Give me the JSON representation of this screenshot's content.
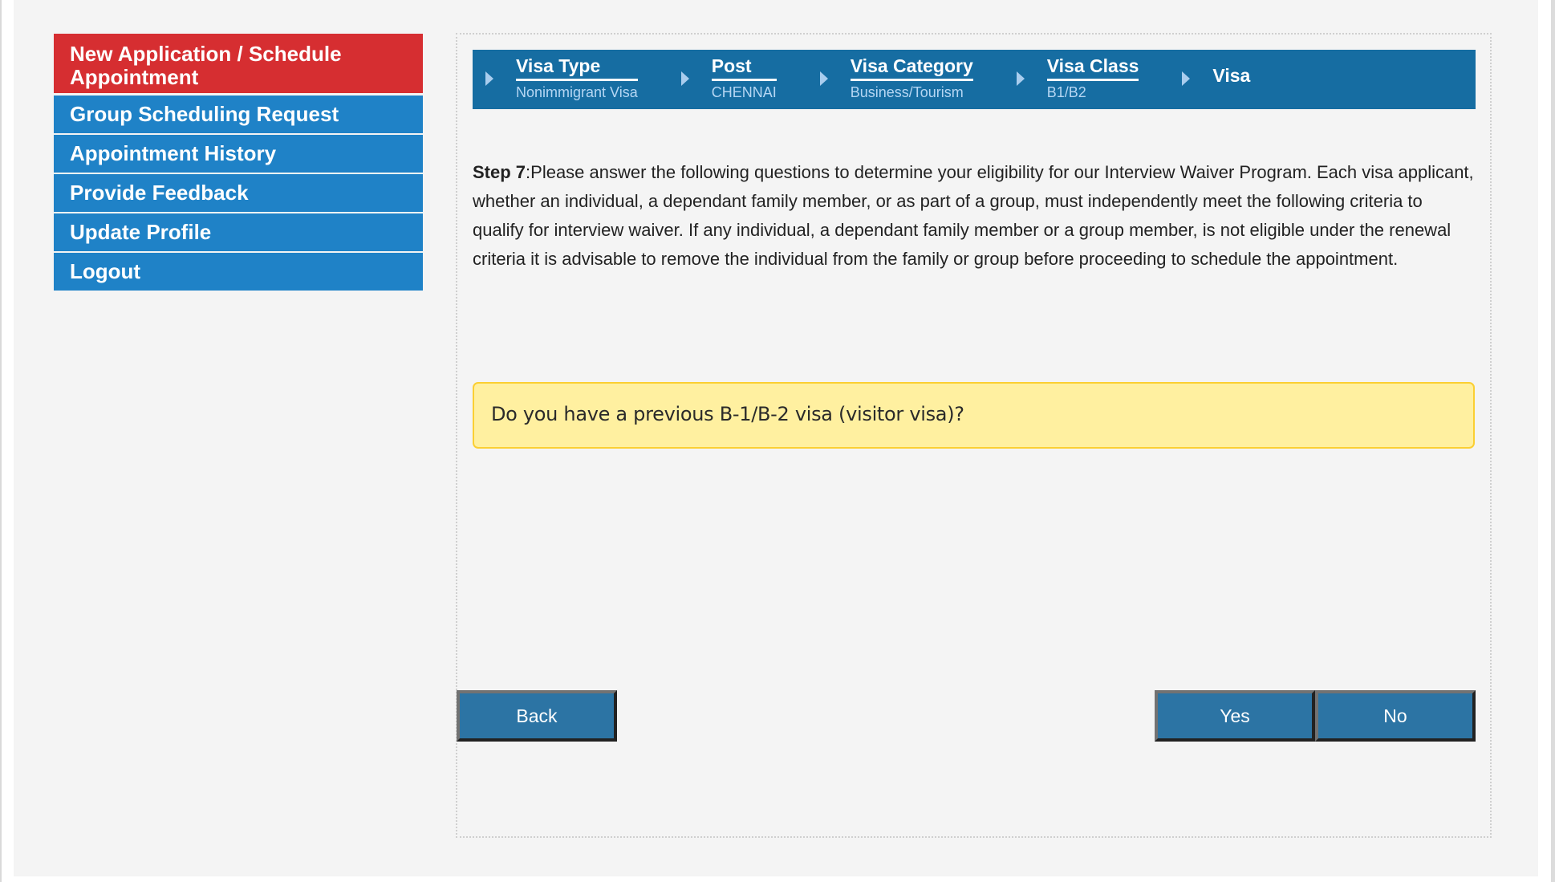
{
  "sidebar": {
    "items": [
      {
        "label": "New Application / Schedule Appointment",
        "active": true
      },
      {
        "label": "Group Scheduling Request"
      },
      {
        "label": "Appointment History"
      },
      {
        "label": "Provide Feedback"
      },
      {
        "label": "Update Profile"
      },
      {
        "label": "Logout"
      }
    ]
  },
  "breadcrumb": [
    {
      "title": "Visa Type",
      "value": "Nonimmigrant Visa"
    },
    {
      "title": "Post",
      "value": "CHENNAI"
    },
    {
      "title": "Visa Category",
      "value": "Business/Tourism"
    },
    {
      "title": "Visa Class",
      "value": "B1/B2"
    },
    {
      "title": "Visa"
    }
  ],
  "step": {
    "label": "Step 7",
    "text": ":Please answer the following questions to determine your eligibility for our Interview Waiver Program. Each visa applicant, whether an individual, a dependant family member, or as part of a group, must independently meet the following criteria to qualify for interview waiver. If any individual, a dependant family member or a group member, is not eligible under the renewal criteria it is advisable to remove the individual from the family or group before proceeding to schedule the appointment."
  },
  "question": "Do you have a previous B-1/B-2 visa (visitor visa)?",
  "buttons": {
    "back": "Back",
    "yes": "Yes",
    "no": "No"
  },
  "colors": {
    "active_nav": "#d62e31",
    "nav": "#1f82c7",
    "breadcrumb_bar": "#166da2",
    "button": "#2c74a4",
    "question_bg": "#fff0a0",
    "question_border": "#fbcf33"
  }
}
